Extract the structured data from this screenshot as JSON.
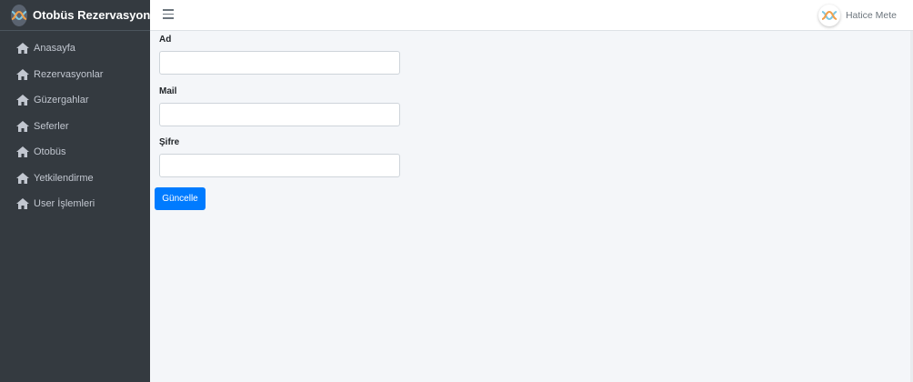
{
  "brand": {
    "title": "Otobüs Rezervasyon"
  },
  "sidebar": {
    "items": [
      {
        "label": "Anasayfa",
        "icon": "home-icon"
      },
      {
        "label": "Rezervasyonlar",
        "icon": "home-icon"
      },
      {
        "label": "Güzergahlar",
        "icon": "home-icon"
      },
      {
        "label": "Seferler",
        "icon": "home-icon"
      },
      {
        "label": "Otobüs",
        "icon": "home-icon"
      },
      {
        "label": "Yetkilendirme",
        "icon": "home-icon"
      },
      {
        "label": "User İşlemleri",
        "icon": "home-icon"
      }
    ]
  },
  "topbar": {
    "menu_icon": "hamburger-icon",
    "user_name": "Hatice Mete"
  },
  "form": {
    "fields": [
      {
        "label": "Ad",
        "value": "",
        "placeholder": ""
      },
      {
        "label": "Mail",
        "value": "",
        "placeholder": ""
      },
      {
        "label": "Şifre",
        "value": "",
        "placeholder": ""
      }
    ],
    "submit_label": "Güncelle"
  },
  "colors": {
    "sidebar_bg": "#343a40",
    "sidebar_text": "#c2c7d0",
    "content_bg": "#f4f6f9",
    "primary": "#007bff"
  }
}
